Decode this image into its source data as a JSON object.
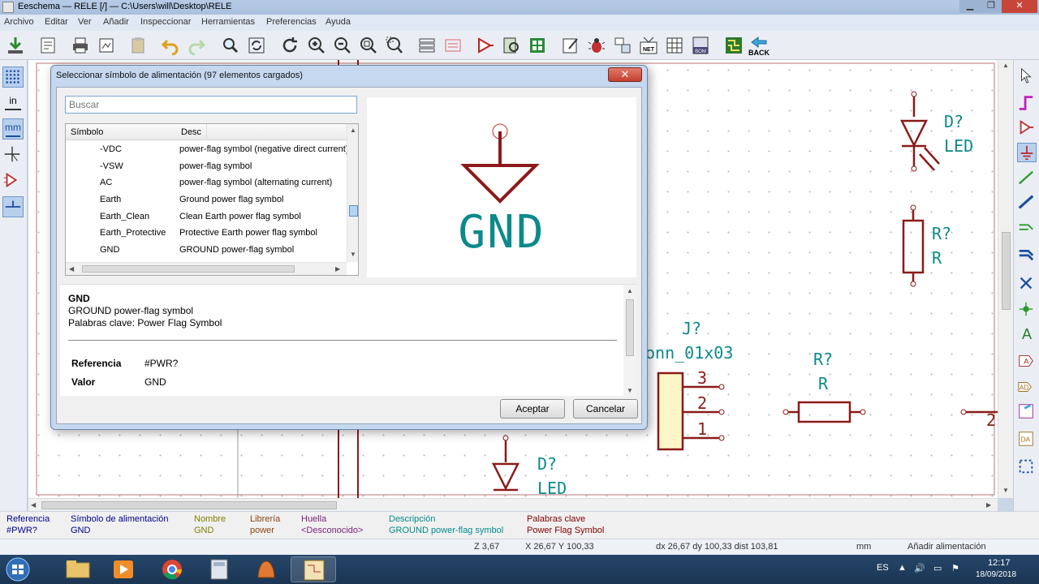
{
  "window": {
    "title": "Eeschema — RELE [/] — C:\\Users\\will\\Desktop\\RELE"
  },
  "menu": [
    "Archivo",
    "Editar",
    "Ver",
    "Añadir",
    "Inspeccionar",
    "Herramientas",
    "Preferencias",
    "Ayuda"
  ],
  "toolbar": {
    "back_label": "BACK"
  },
  "left_toolbar": {
    "units_in": "in",
    "units_mm": "mm"
  },
  "schematic": {
    "d1_ref": "D?",
    "d1_val": "LED",
    "r1_ref": "R?",
    "r1_val": "R",
    "j_ref": "J?",
    "j_val": "onn_01x03",
    "pin3": "3",
    "pin2": "2",
    "pin1": "1",
    "r2_ref": "R?",
    "r2_val": "R",
    "d2_ref": "D?",
    "d2_val": "LED",
    "edge_num": "2"
  },
  "dialog": {
    "title": "Seleccionar símbolo de alimentación (97 elementos cargados)",
    "search_placeholder": "Buscar",
    "col_symbol": "Símbolo",
    "col_desc": "Desc",
    "rows": [
      {
        "name": "-VDC",
        "desc": "power-flag symbol (negative direct current)"
      },
      {
        "name": "-VSW",
        "desc": "power-flag symbol"
      },
      {
        "name": "AC",
        "desc": "power-flag symbol (alternating current)"
      },
      {
        "name": "Earth",
        "desc": "Ground power flag symbol"
      },
      {
        "name": "Earth_Clean",
        "desc": "Clean Earth power flag symbol"
      },
      {
        "name": "Earth_Protective",
        "desc": "Protective Earth power flag symbol"
      },
      {
        "name": "GND",
        "desc": "GROUND power-flag symbol"
      }
    ],
    "preview_label": "GND",
    "info": {
      "name": "GND",
      "desc": "GROUND power-flag symbol",
      "keywords": "Palabras clave: Power Flag Symbol",
      "ref_label": "Referencia",
      "ref_value": "#PWR?",
      "val_label": "Valor",
      "val_value": "GND"
    },
    "ok": "Aceptar",
    "cancel": "Cancelar"
  },
  "message_panel": [
    {
      "h": "Referencia",
      "v": "#PWR?"
    },
    {
      "h": "Símbolo de alimentación",
      "v": "GND"
    },
    {
      "h": "Nombre",
      "v": "GND"
    },
    {
      "h": "Librería",
      "v": "power"
    },
    {
      "h": "Huella",
      "v": "<Desconocido>"
    },
    {
      "h": "Descripción",
      "v": "GROUND power-flag symbol"
    },
    {
      "h": "Palabras clave",
      "v": "Power Flag Symbol"
    }
  ],
  "status": {
    "zoom": "Z 3,67",
    "xy": "X 26,67  Y 100,33",
    "dxy": "dx 26,67  dy 100,33  dist 103,81",
    "units": "mm",
    "mode": "Añadir alimentación"
  },
  "taskbar": {
    "lang": "ES",
    "time": "12:17",
    "date": "18/09/2018"
  },
  "colors": {
    "wire": "#8b1a1a",
    "text": "#0c8a8a",
    "connector_fill": "#fff6c8"
  }
}
